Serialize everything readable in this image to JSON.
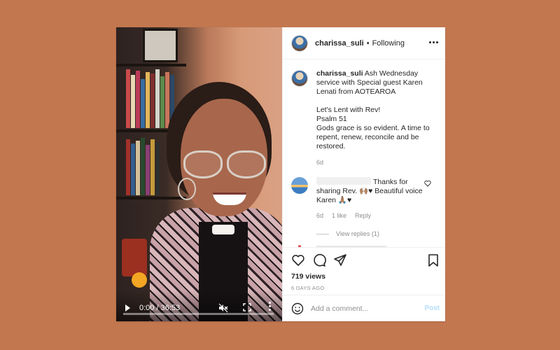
{
  "post": {
    "username": "charissa_suli",
    "follow_status": "Following",
    "separator": "•",
    "caption": {
      "username": "charissa_suli",
      "lines": [
        "Ash Wednesday service with Special guest Karen Lenati from AOTEAROA",
        "",
        "Let's Lent with Rev!",
        "Psalm 51",
        "Gods grace is so evident. A time to repent, renew, reconcile and be restored."
      ],
      "time": "6d"
    },
    "comments": [
      {
        "text": "Thanks for sharing Rev. 🙌🏽♥ Beautiful voice Karen 🙏🏽♥",
        "time": "6d",
        "likes": "1 like",
        "reply_label": "Reply",
        "view_replies": "View replies (1)"
      }
    ],
    "views": "719 views",
    "date": "6 DAYS AGO",
    "add_comment_placeholder": "Add a comment...",
    "post_button": "Post"
  },
  "video": {
    "time": "0:00 / 36:53",
    "progress": 0
  },
  "icons": {
    "like": "heart-icon",
    "comment": "comment-icon",
    "share": "share-icon",
    "save": "bookmark-icon",
    "emoji": "emoji-icon",
    "more": "more-icon"
  },
  "colors": {
    "background": "#c3774f",
    "post_button": "#b2dffc",
    "muted_text": "#8e8e8e"
  }
}
